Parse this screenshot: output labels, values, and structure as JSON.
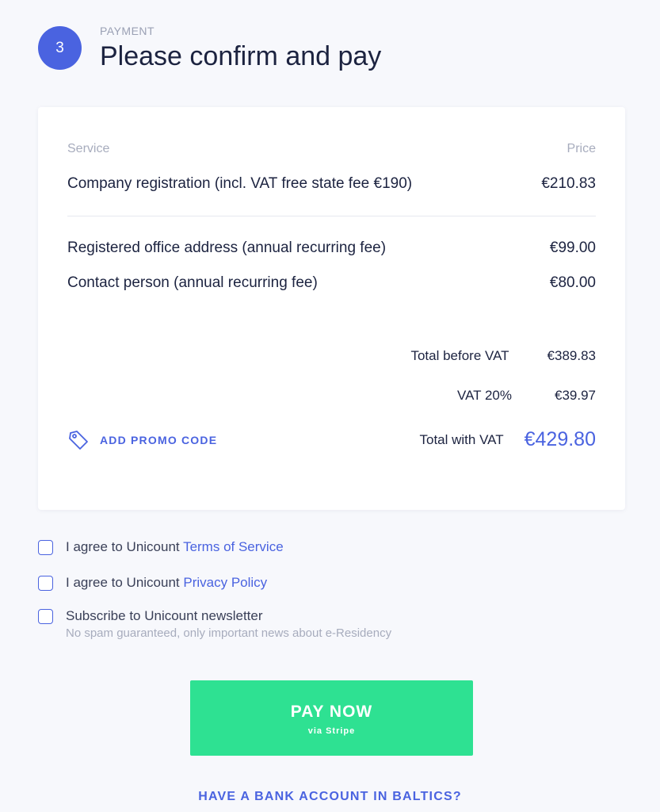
{
  "step": {
    "number": "3",
    "label": "PAYMENT",
    "title": "Please confirm and pay"
  },
  "table": {
    "header_service": "Service",
    "header_price": "Price",
    "items": [
      {
        "service": "Company registration (incl. VAT free state fee €190)",
        "price": "€210.83"
      },
      {
        "service": "Registered office address (annual recurring fee)",
        "price": "€99.00"
      },
      {
        "service": "Contact person (annual recurring fee)",
        "price": "€80.00"
      }
    ]
  },
  "totals": {
    "before_vat_label": "Total before VAT",
    "before_vat_value": "€389.83",
    "vat_label": "VAT 20%",
    "vat_value": "€39.97",
    "with_vat_label": "Total with VAT",
    "with_vat_value": "€429.80"
  },
  "promo": {
    "label": "ADD PROMO CODE",
    "icon": "tag-icon"
  },
  "agreements": {
    "terms_prefix": "I agree to Unicount ",
    "terms_link": "Terms of Service",
    "privacy_prefix": "I agree to Unicount ",
    "privacy_link": "Privacy Policy",
    "newsletter": "Subscribe to Unicount newsletter",
    "newsletter_sub": "No spam guaranteed, only important news about e-Residency"
  },
  "pay_button": {
    "label": "PAY NOW",
    "sub": "via Stripe"
  },
  "bank_link": "HAVE A BANK ACCOUNT IN BALTICS?",
  "colors": {
    "accent": "#4a63e0",
    "pay": "#2ee192",
    "background": "#f7f8fc"
  }
}
